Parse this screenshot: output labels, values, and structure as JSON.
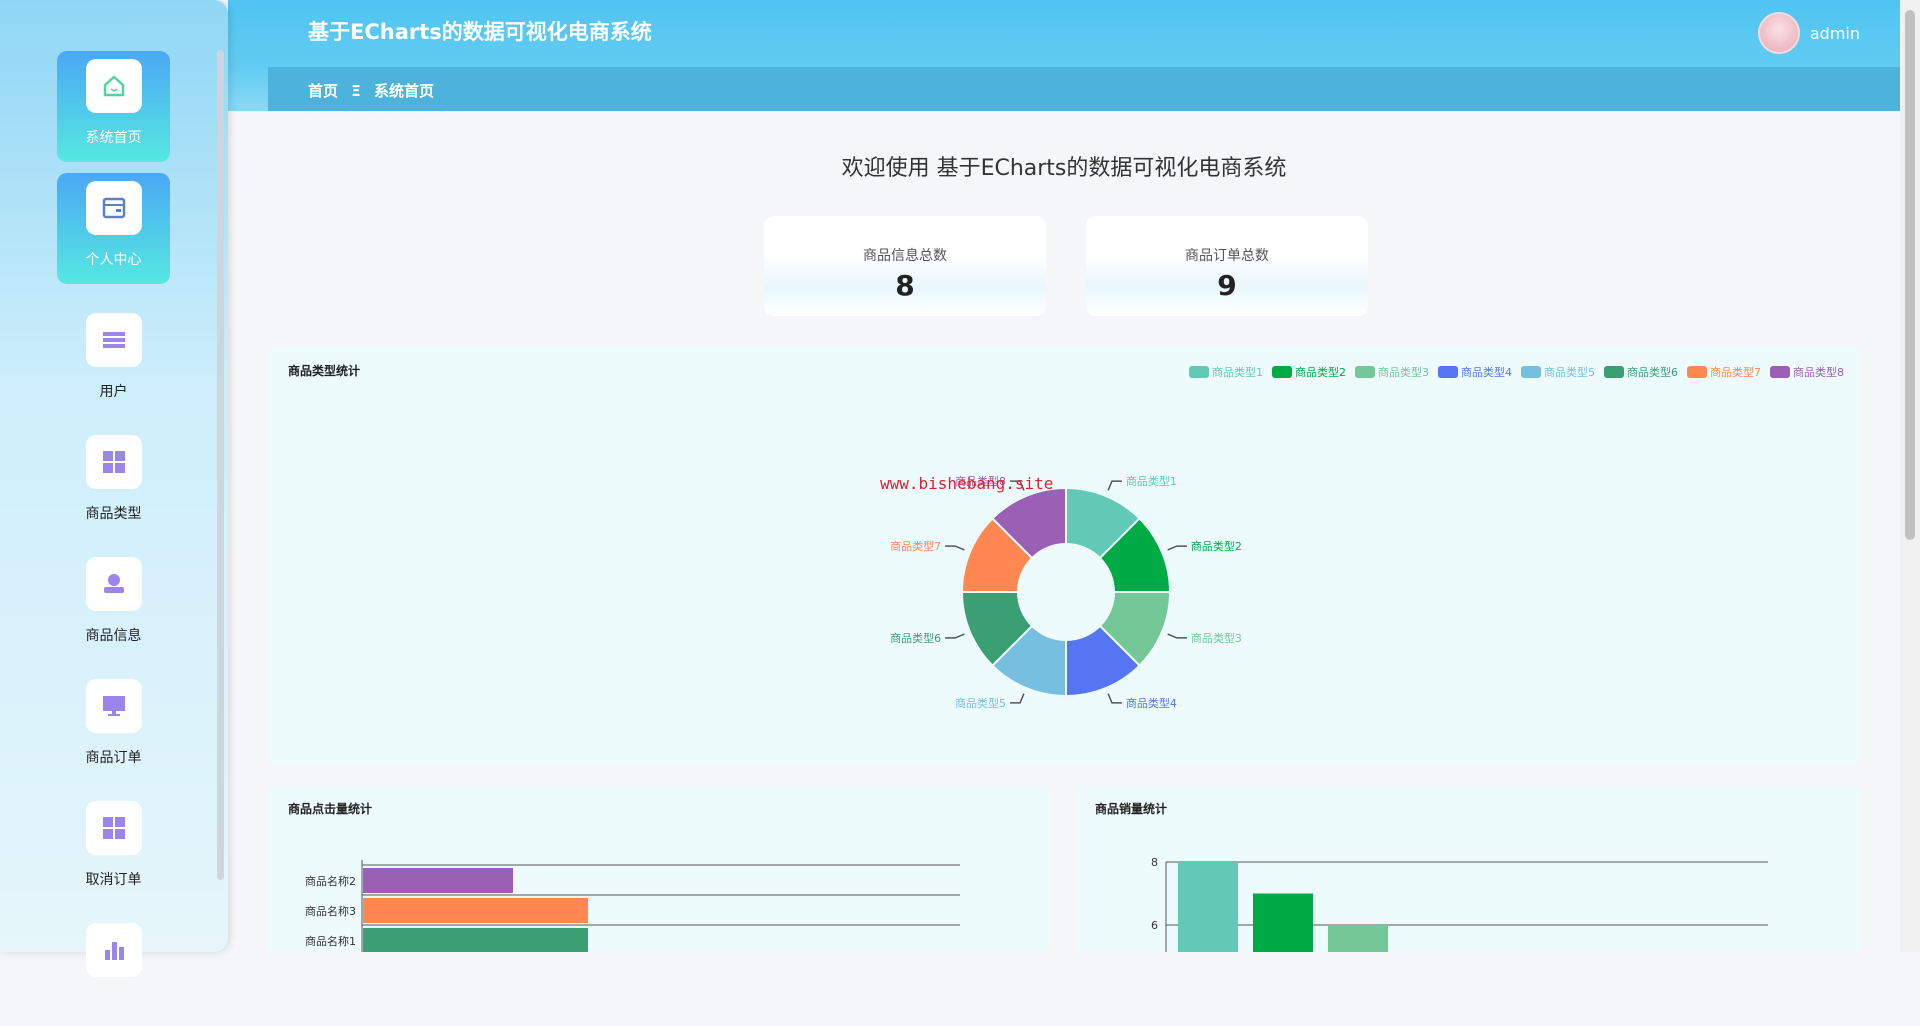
{
  "header": {
    "title": "基于ECharts的数据可视化电商系统",
    "username": "admin"
  },
  "breadcrumb": {
    "home": "首页",
    "separator": "Ξ",
    "current": "系统首页"
  },
  "sidebar": {
    "items": [
      {
        "label": "系统首页",
        "icon": "home-icon"
      },
      {
        "label": "个人中心",
        "icon": "card-icon"
      },
      {
        "label": "用户",
        "icon": "list-icon"
      },
      {
        "label": "商品类型",
        "icon": "grid-icon"
      },
      {
        "label": "商品信息",
        "icon": "user-icon"
      },
      {
        "label": "商品订单",
        "icon": "monitor-icon"
      },
      {
        "label": "取消订单",
        "icon": "grid-icon"
      },
      {
        "label": "",
        "icon": "bar-chart-icon"
      }
    ]
  },
  "welcome": "欢迎使用 基于ECharts的数据可视化电商系统",
  "stats": [
    {
      "label": "商品信息总数",
      "value": "8"
    },
    {
      "label": "商品订单总数",
      "value": "9"
    }
  ],
  "watermark": "www.bishebang.site",
  "chart_data": [
    {
      "type": "pie",
      "title": "商品类型统计",
      "legend_position": "top-right",
      "categories": [
        "商品类型1",
        "商品类型2",
        "商品类型3",
        "商品类型4",
        "商品类型5",
        "商品类型6",
        "商品类型7",
        "商品类型8"
      ],
      "values": [
        1,
        1,
        1,
        1,
        1,
        1,
        1,
        1
      ],
      "colors": [
        "#62c9b6",
        "#00ab45",
        "#74c897",
        "#5675f2",
        "#76bfe0",
        "#3c9f74",
        "#ff8751",
        "#9c5fb6"
      ]
    },
    {
      "type": "bar",
      "orientation": "horizontal",
      "title": "商品点击量统计",
      "categories": [
        "商品名称2",
        "商品名称3",
        "商品名称1"
      ],
      "values": [
        2,
        3,
        3
      ],
      "xlim": [
        0,
        8
      ],
      "colors": [
        "#9c5fb6",
        "#ff8751",
        "#3c9f74"
      ]
    },
    {
      "type": "bar",
      "title": "商品销量统计",
      "categories": [
        "",
        "",
        ""
      ],
      "values": [
        8,
        7,
        6
      ],
      "yticks": [
        "8",
        "6"
      ],
      "ylim": [
        4,
        8
      ],
      "colors": [
        "#62c9b6",
        "#00ab45",
        "#74c897"
      ]
    }
  ]
}
